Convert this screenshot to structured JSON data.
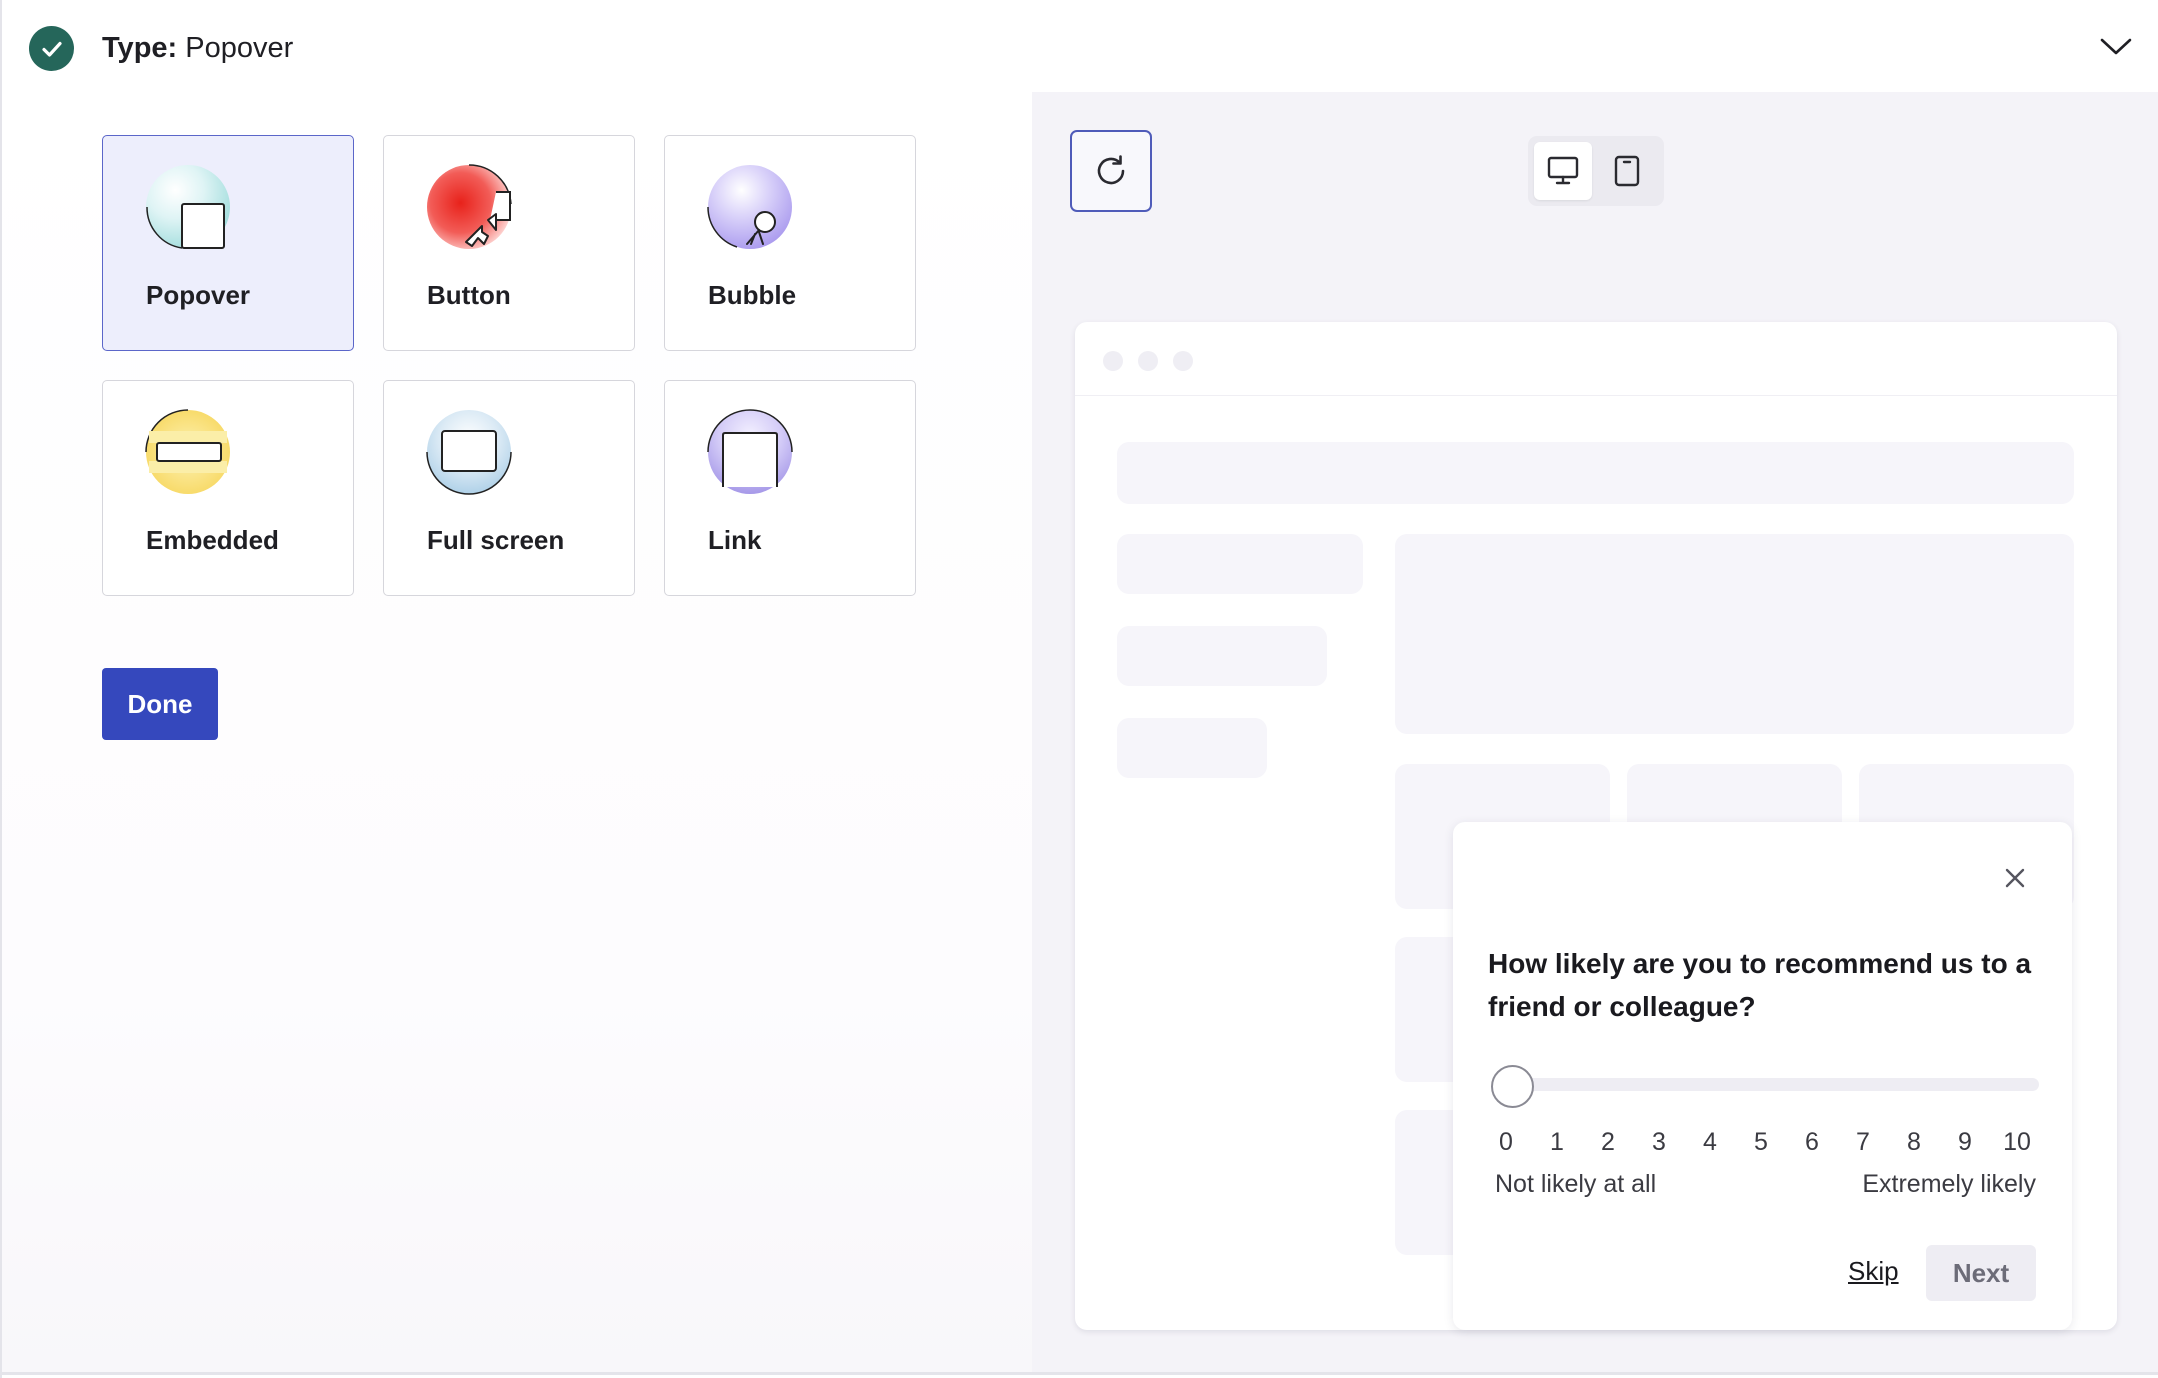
{
  "header": {
    "title_key": "Type:",
    "title_value": "Popover",
    "icons": {
      "status": "check-circle-icon",
      "collapse": "chevron-down-icon"
    }
  },
  "types": {
    "selected": "Popover",
    "items": [
      {
        "label": "Popover",
        "icon": "popover-icon"
      },
      {
        "label": "Button",
        "icon": "button-icon"
      },
      {
        "label": "Bubble",
        "icon": "bubble-icon"
      },
      {
        "label": "Embedded",
        "icon": "embedded-icon"
      },
      {
        "label": "Full screen",
        "icon": "full-screen-icon"
      },
      {
        "label": "Link",
        "icon": "link-icon"
      }
    ]
  },
  "done_label": "Done",
  "preview": {
    "toolbar": {
      "refresh_icon": "refresh-icon",
      "desktop_icon": "desktop-icon",
      "mobile_icon": "mobile-icon",
      "active_device": "desktop"
    },
    "survey": {
      "question": "How likely are you to recommend us to a friend or colleague?",
      "scale": [
        "0",
        "1",
        "2",
        "3",
        "4",
        "5",
        "6",
        "7",
        "8",
        "9",
        "10"
      ],
      "low_label": "Not likely at all",
      "high_label": "Extremely likely",
      "slider_value": 0,
      "skip_label": "Skip",
      "next_label": "Next"
    }
  },
  "colors": {
    "primary": "#3548bd",
    "success": "#25665a",
    "selected_card_bg": "#edeefc",
    "preview_bg": "#f4f3f8"
  }
}
